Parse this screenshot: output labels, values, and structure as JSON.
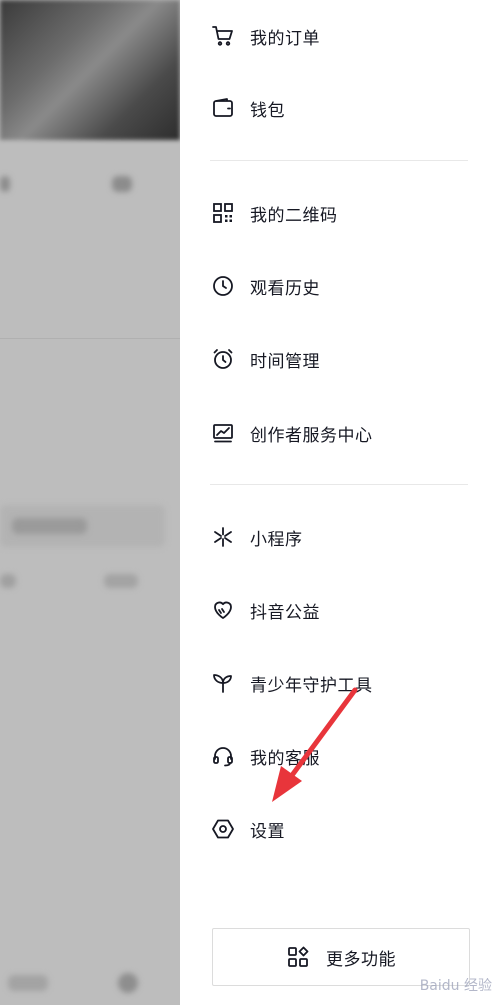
{
  "menu": {
    "items": [
      {
        "label": "我的订单",
        "icon": "cart-icon"
      },
      {
        "label": "钱包",
        "icon": "wallet-icon"
      },
      {
        "label": "我的二维码",
        "icon": "qrcode-icon"
      },
      {
        "label": "观看历史",
        "icon": "clock-icon"
      },
      {
        "label": "时间管理",
        "icon": "alarm-clock-icon"
      },
      {
        "label": "创作者服务中心",
        "icon": "monitor-chart-icon"
      },
      {
        "label": "小程序",
        "icon": "mini-program-icon"
      },
      {
        "label": "抖音公益",
        "icon": "heart-icon"
      },
      {
        "label": "青少年守护工具",
        "icon": "sprout-icon"
      },
      {
        "label": "我的客服",
        "icon": "headset-icon"
      },
      {
        "label": "设置",
        "icon": "hexagon-settings-icon"
      }
    ]
  },
  "more_button": {
    "label": "更多功能",
    "icon": "apps-grid-icon"
  },
  "annotation": {
    "color": "#e8353b",
    "icon": "red-arrow"
  },
  "watermark": {
    "text": "Baidu 经验"
  }
}
